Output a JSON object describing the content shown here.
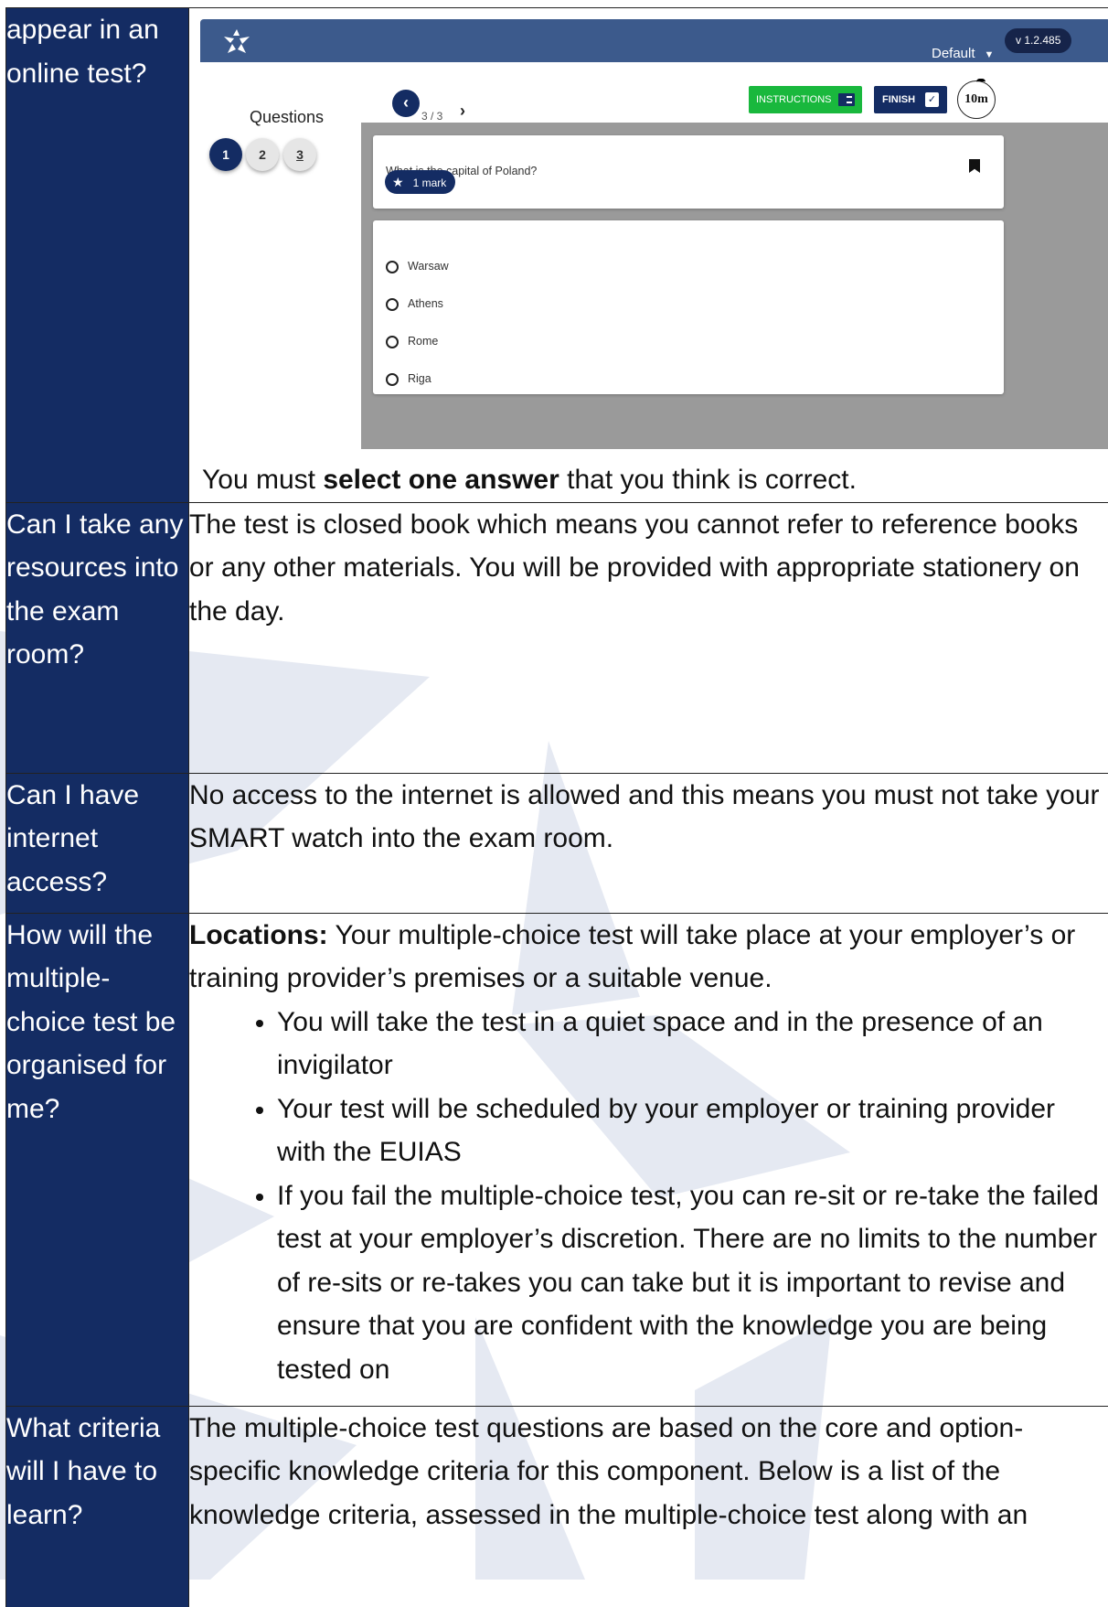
{
  "rows": [
    {
      "question": "appear in an online test?",
      "app": {
        "profile": "Default",
        "version": "v 1.2.485",
        "questions_title": "Questions",
        "question_numbers": [
          "1",
          "2",
          "3"
        ],
        "pager": "3 / 3",
        "instructions_label": "INSTRUCTIONS",
        "finish_label": "FINISH",
        "timer": "10m",
        "question_text": "What is the capital of Poland?",
        "mark_label": "1 mark",
        "options": [
          "Warsaw",
          "Athens",
          "Rome",
          "Riga"
        ],
        "colors": {
          "header": "#3c5a8c",
          "navy": "#142c63",
          "green": "#19b83d",
          "panel": "#9a9a9a"
        }
      },
      "note_pre": "You must ",
      "note_bold": "select one answer",
      "note_post": " that you think is correct."
    },
    {
      "question": "Can I take any resources into the exam room?",
      "answer": "The test is closed book which means you cannot refer to reference books or any other materials. You will be provided with appropriate stationery on the day."
    },
    {
      "question": "Can I have internet access?",
      "answer": "No access to the internet is allowed and this means you must not take your SMART watch into the exam room."
    },
    {
      "question": "How will the multiple-choice test be organised for me?",
      "answer_bold": "Locations:",
      "answer": " Your multiple-choice test will take place at your employer’s or training provider’s premises or a suitable venue.",
      "bullets": [
        "You will take the test in a quiet space and in the presence of an invigilator",
        "Your test will be scheduled by your employer or training provider with the EUIAS",
        "If you fail the multiple-choice test, you can re-sit or re-take the failed test at your employer’s discretion. There are no limits to the number of re-sits or re-takes you can take but it is important to revise and ensure that you are confident with the knowledge you are being tested on"
      ]
    },
    {
      "question": "What criteria will I have to learn?",
      "answer": "The multiple-choice test questions are based on the core and option-specific knowledge criteria for this component. Below is a list of the knowledge criteria, assessed in the multiple-choice test along with an"
    }
  ],
  "colors": {
    "question_cell": "#142c63",
    "watermark": "#e4e8f1"
  }
}
